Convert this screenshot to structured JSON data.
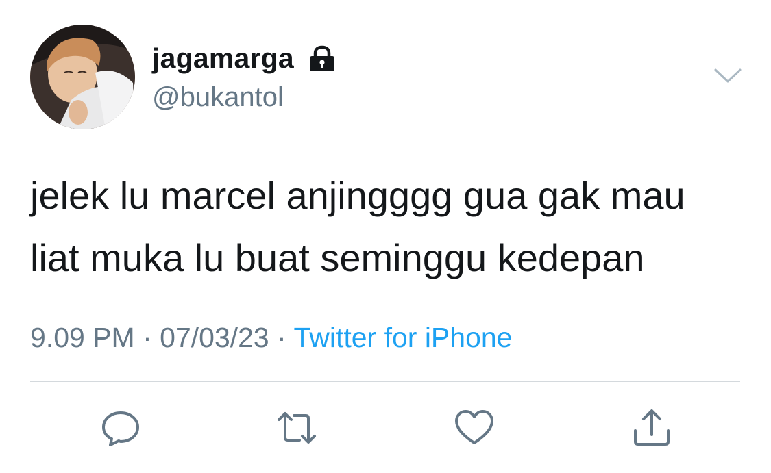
{
  "tweet": {
    "display_name": "jagamarga",
    "handle": "@bukantol",
    "text_line1": "jelek lu marcel anjingggg gua gak mau",
    "text_line2": "liat muka lu buat seminggu kedepan",
    "time": "9.09 PM",
    "separator": " · ",
    "date": "07/03/23",
    "source": "Twitter for iPhone"
  },
  "icons": {
    "lock": "lock-icon",
    "chevron": "chevron-down-icon",
    "reply": "reply-icon",
    "retweet": "retweet-icon",
    "like": "heart-icon",
    "share": "share-icon"
  },
  "colors": {
    "text": "#14171a",
    "secondary": "#657786",
    "link": "#1da1f2",
    "divider": "#d4d9dd"
  }
}
